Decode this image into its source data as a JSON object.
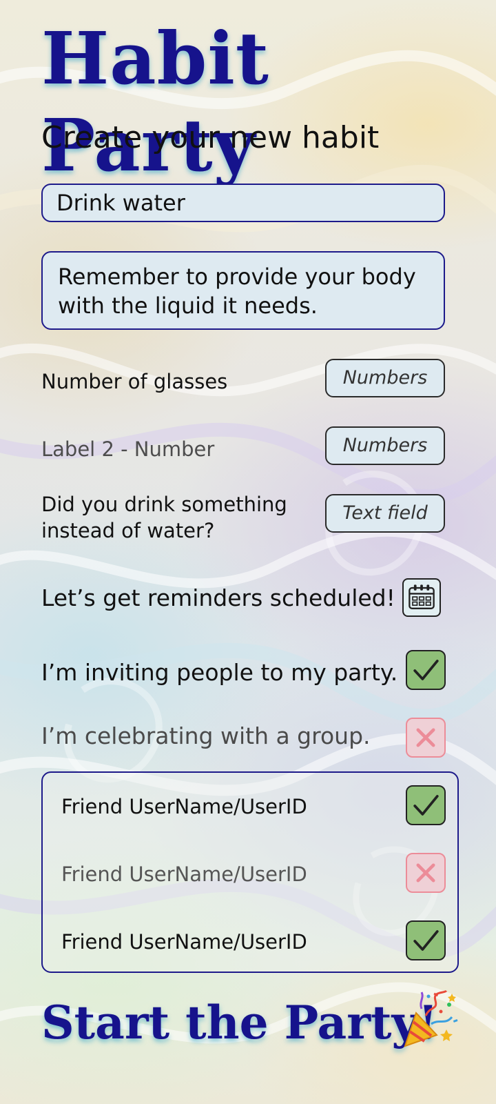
{
  "app": {
    "title": "Habit Party",
    "subtitle": "Create your new habit"
  },
  "form": {
    "habit_name": "Drink water",
    "habit_description": "Remember to provide your body with the liquid it needs.",
    "rows": [
      {
        "label": "Number of glasses",
        "placeholder": "Numbers",
        "muted": false
      },
      {
        "label": "Label 2 - Number",
        "placeholder": "Numbers",
        "muted": true
      },
      {
        "label": "Did you drink something instead of water?",
        "placeholder": "Text field",
        "muted": false
      }
    ],
    "reminders_label": "Let’s get reminders scheduled!",
    "invite_label": "I’m inviting people to my party.",
    "invite_checked": true,
    "group_label": "I’m celebrating with a group.",
    "group_checked": false
  },
  "friends": [
    {
      "label": "Friend UserName/UserID",
      "checked": true
    },
    {
      "label": "Friend UserName/UserID",
      "checked": false
    },
    {
      "label": "Friend UserName/UserID",
      "checked": true
    }
  ],
  "cta": {
    "label": "Start the Party!",
    "icon": "party-popper-icon"
  },
  "colors": {
    "brand": "#16138c",
    "check_green": "#8fbf78",
    "cross_pink": "#ec8c98",
    "field_bg": "#deeaf1"
  },
  "icons": {
    "calendar": "calendar-icon",
    "checked": "checkmark-icon",
    "unchecked": "cross-icon"
  }
}
